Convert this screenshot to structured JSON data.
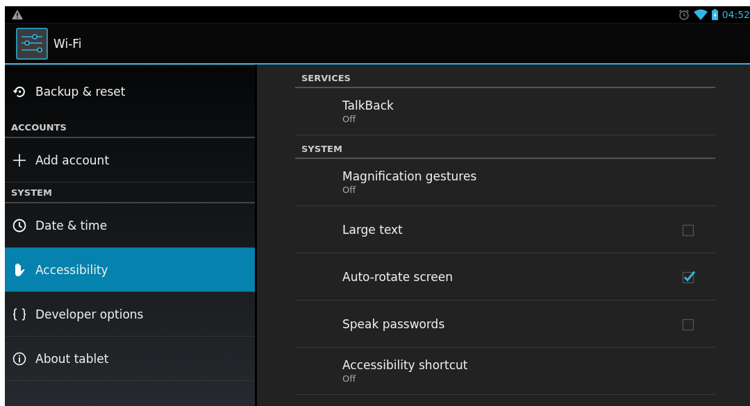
{
  "status_bar": {
    "time": "04:52"
  },
  "action_bar": {
    "title": "Wi-Fi"
  },
  "sidebar": {
    "items": [
      {
        "kind": "item",
        "label": "Backup & reset",
        "selected": false
      },
      {
        "kind": "header",
        "label": "ACCOUNTS"
      },
      {
        "kind": "item",
        "label": "Add account",
        "selected": false
      },
      {
        "kind": "header",
        "label": "SYSTEM"
      },
      {
        "kind": "item",
        "label": "Date & time",
        "selected": false
      },
      {
        "kind": "item",
        "label": "Accessibility",
        "selected": true
      },
      {
        "kind": "item",
        "label": "Developer options",
        "selected": false
      },
      {
        "kind": "item",
        "label": "About tablet",
        "selected": false
      }
    ]
  },
  "settings": [
    {
      "kind": "header",
      "label": "SERVICES"
    },
    {
      "kind": "summary",
      "title": "TalkBack",
      "summary": "Off"
    },
    {
      "kind": "header",
      "label": "SYSTEM"
    },
    {
      "kind": "summary",
      "title": "Magnification gestures",
      "summary": "Off"
    },
    {
      "kind": "checkbox",
      "title": "Large text",
      "checked": false
    },
    {
      "kind": "checkbox",
      "title": "Auto-rotate screen",
      "checked": true
    },
    {
      "kind": "checkbox",
      "title": "Speak passwords",
      "checked": false
    },
    {
      "kind": "summary",
      "title": "Accessibility shortcut",
      "summary": "Off"
    }
  ]
}
